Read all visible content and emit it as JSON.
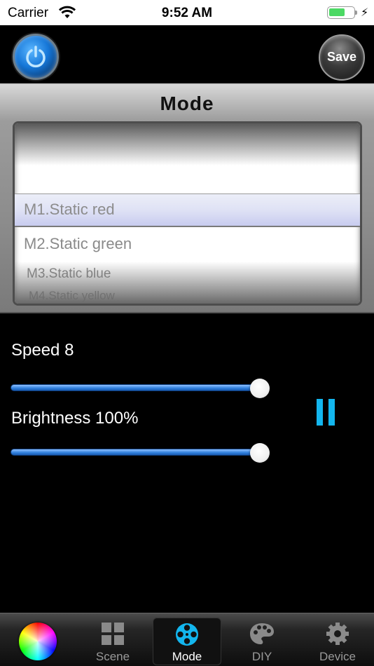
{
  "status_bar": {
    "carrier": "Carrier",
    "time": "9:52 AM",
    "battery_icon": "battery-charging-icon",
    "wifi_icon": "wifi-icon"
  },
  "header": {
    "power_icon": "power-icon",
    "save_label": "Save"
  },
  "mode_panel": {
    "title": "Mode",
    "selected_index": 0,
    "items": [
      "M1.Static red",
      "M2.Static green",
      "M3.Static blue",
      "M4.Static yellow"
    ]
  },
  "controls": {
    "speed_label": "Speed  8",
    "speed_value": 8,
    "speed_fraction": 1.0,
    "brightness_label": "Brightness 100%",
    "brightness_fraction": 1.0,
    "pause_icon": "pause-icon"
  },
  "tab_bar": {
    "tabs": [
      {
        "label": "",
        "icon": "color-wheel-icon"
      },
      {
        "label": "Scene",
        "icon": "grid-icon"
      },
      {
        "label": "Mode",
        "icon": "film-reel-icon",
        "active": true
      },
      {
        "label": "DIY",
        "icon": "palette-icon"
      },
      {
        "label": "Device",
        "icon": "gear-icon"
      }
    ]
  },
  "colors": {
    "accent": "#13b6ee",
    "slider": "#2f7fdd",
    "battery": "#4cd964"
  }
}
